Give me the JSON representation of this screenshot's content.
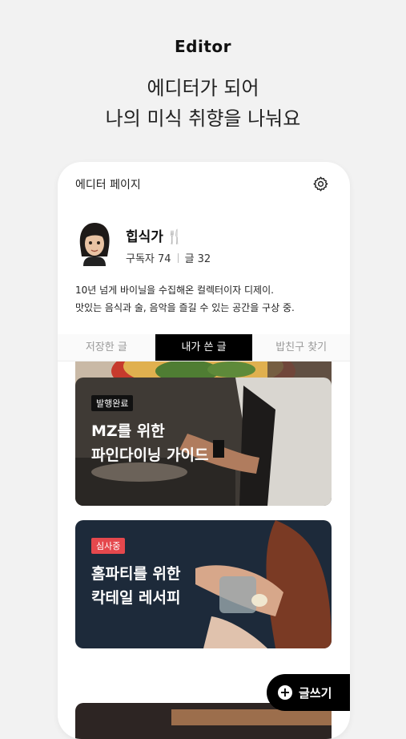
{
  "promo": {
    "title": "Editor",
    "line1": "에디터가 되어",
    "line2": "나의 미식 취향을 나눠요"
  },
  "app": {
    "page_title": "에디터 페이지",
    "settings_icon": "gear-icon",
    "profile": {
      "name": "힙식가",
      "name_icon": "🍴",
      "subscribers_label": "구독자 74",
      "posts_label": "글 32",
      "bio_line1": "10년 넘게 바이닐을 수집해온 컬렉터이자 디제이.",
      "bio_line2": "맛있는 음식과 술, 음악을 즐길 수 있는 공간을 구상 중."
    },
    "tabs": [
      {
        "label": "저장한 글",
        "active": false
      },
      {
        "label": "내가 쓴 글",
        "active": true
      },
      {
        "label": "밥친구 찾기",
        "active": false
      }
    ],
    "cards": [
      {
        "badge": "",
        "line1": "",
        "line2": ""
      },
      {
        "badge": "발행완료",
        "badge_color": "#111111",
        "line1": "MZ를 위한",
        "line2": "파인다이닝 가이드"
      },
      {
        "badge": "심사중",
        "badge_color": "#e5484d",
        "line1": "홈파티를 위한",
        "line2": "칵테일 레서피"
      }
    ],
    "write_button": "글쓰기"
  }
}
